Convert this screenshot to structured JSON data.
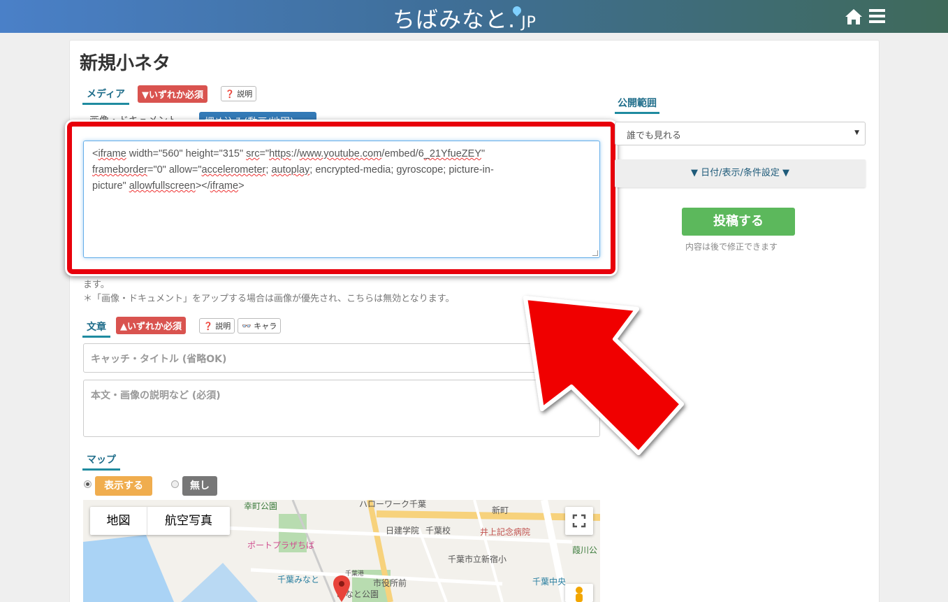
{
  "header": {
    "logo_main": "ちばみなと.",
    "logo_jp": "JP"
  },
  "page": {
    "title": "新規小ネタ"
  },
  "media": {
    "label": "メディア",
    "required_badge": "▼いずれか必須",
    "help": "説明",
    "tab_image": "画像・ドキュメント",
    "tab_embed": "埋め込み(動画/地図)",
    "embed_code_parts": [
      "<iframe width=\"560\" height=\"315\" src=\"https://www.youtube.com/embed/6_21YfueZEY\"",
      "frameboder=\"0\" allow=\"accelerometer; autoplay; encrypted-media; gyroscope; picture-in-",
      "picture\" allowfullscreen></iframe>"
    ],
    "note1": "ます。",
    "note2": "＊「画像・ドキュメント」をアップする場合は画像が優先され、こちらは無効となります。"
  },
  "text_section": {
    "label": "文章",
    "required_badge": "▲いずれか必須",
    "help": "説明",
    "chara": "キャラ",
    "title_placeholder": "キャッチ・タイトル (省略OK)",
    "body_placeholder": "本文・画像の説明など (必須)"
  },
  "map_section": {
    "label": "マップ",
    "show_label": "表示する",
    "none_label": "無し",
    "tab_map": "地図",
    "tab_aerial": "航空写真",
    "places": [
      "幸町公園",
      "ハローワーク千葉",
      "新町",
      "日建学院",
      "千葉校",
      "井上記念病院",
      "ポートプラザちば",
      "千葉市立新宿小",
      "葭川公",
      "千葉みなと",
      "市役所前",
      "千葉中央",
      "みなと公園",
      "千葉港"
    ]
  },
  "sidebar": {
    "visibility_label": "公開範囲",
    "visibility_value": "誰でも見れる",
    "date_settings": "▼ 日付/表示/条件設定 ▼",
    "post_button": "投稿する",
    "post_note": "内容は後で修正できます"
  },
  "colors": {
    "highlight": "#e8000b",
    "accent": "#1f8ba0",
    "post": "#5cb85c"
  }
}
